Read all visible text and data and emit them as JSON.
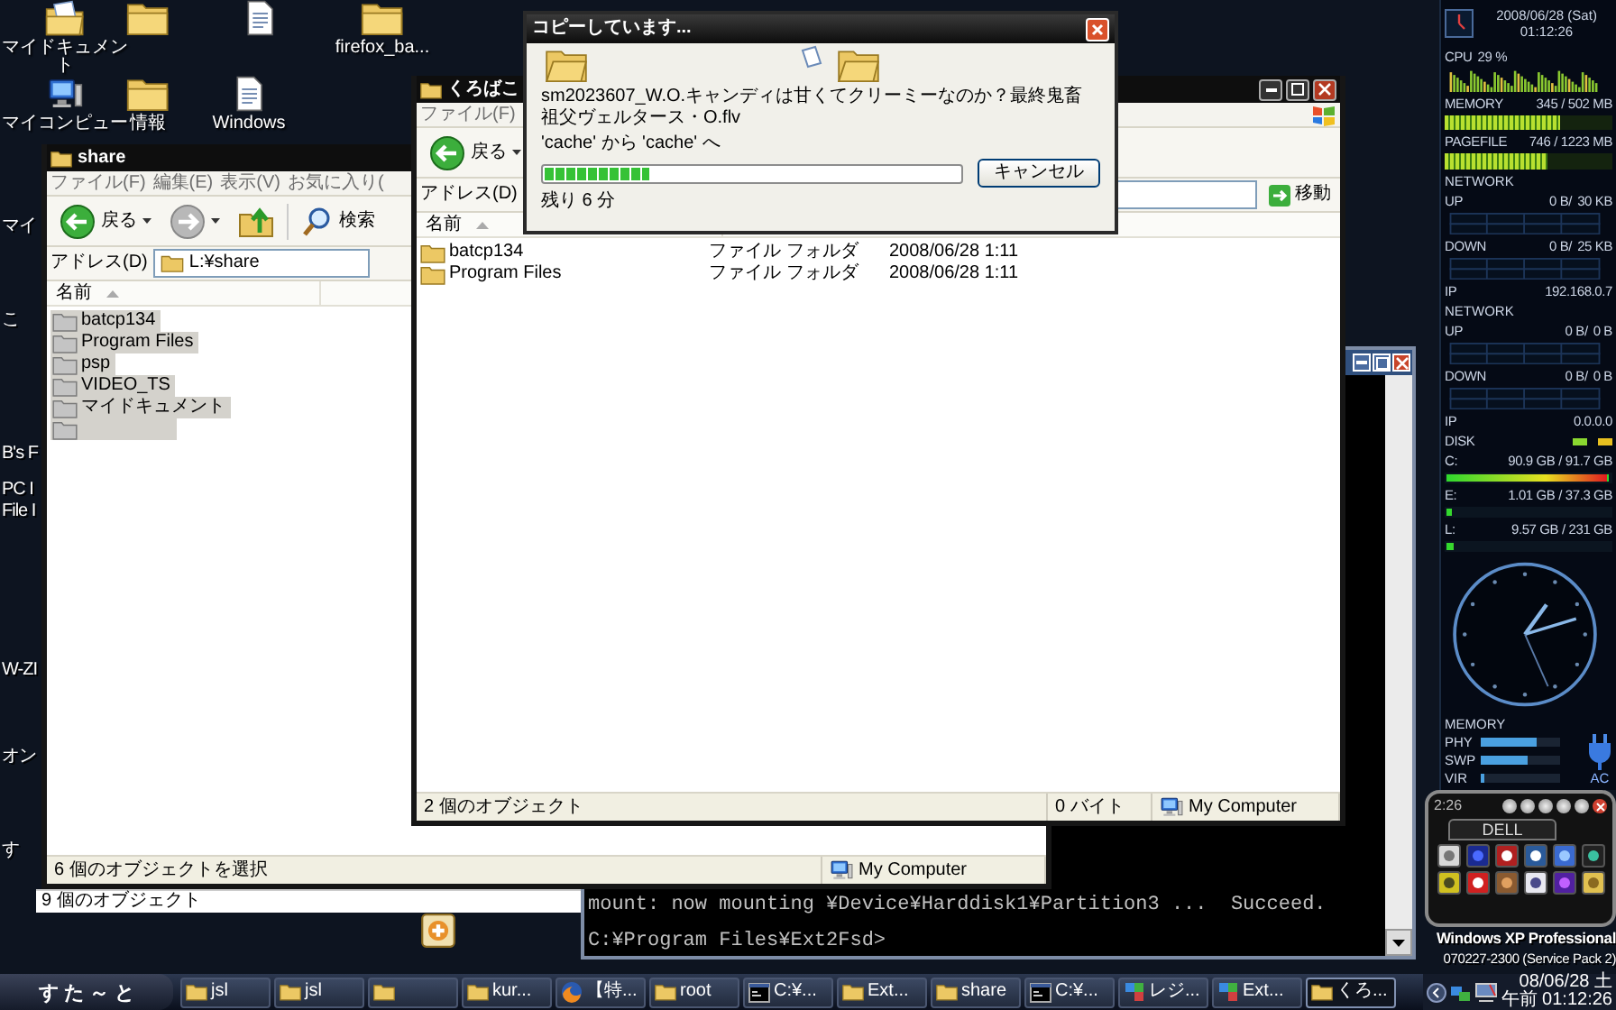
{
  "desktop": {
    "icons": [
      {
        "kind": "documents",
        "label": "マイドキュメント"
      },
      {
        "kind": "folder"
      },
      {
        "kind": "file"
      },
      {
        "kind": "folder",
        "label": "firefox_ba..."
      },
      {
        "kind": "computer",
        "label": "マイコンピュー"
      },
      {
        "kind": "folder",
        "label": "情報"
      },
      {
        "kind": "file",
        "label": "Windows"
      },
      {
        "kind": "app"
      }
    ],
    "edge_labels": [
      "マイ",
      "こ",
      "B's F",
      "PC I",
      "File I",
      "W-ZI",
      "オン",
      "す"
    ]
  },
  "back_window": {
    "status": "9 個のオブジェクト"
  },
  "console": {
    "lines": [
      "mount: now mounting ¥Device¥Harddisk1¥Partition3 ...  Succeed.",
      "C:¥Program Files¥Ext2Fsd>"
    ]
  },
  "share_window": {
    "title": "share",
    "menu": [
      "ファイル(F)",
      "編集(E)",
      "表示(V)",
      "お気に入り("
    ],
    "back": "戻る",
    "search": "検索",
    "address_label": "アドレス(D)",
    "address": "L:¥share",
    "column": "名前",
    "items": [
      {
        "name": "batcp134",
        "selected": true
      },
      {
        "name": "Program Files",
        "selected": true
      },
      {
        "name": "psp",
        "selected": true
      },
      {
        "name": "VIDEO_TS",
        "selected": true
      },
      {
        "name": "マイドキュメント",
        "selected": true
      },
      {
        "selected": true
      }
    ],
    "status": "6 個のオブジェクトを選択",
    "location": "My Computer"
  },
  "explorer_window": {
    "title": "くろばこ",
    "menu": [
      "ファイル(F)"
    ],
    "back": "戻る",
    "address_label": "アドレス(D)",
    "go": "移動",
    "column": "名前",
    "rows": [
      {
        "name": "batcp134",
        "type": "ファイル フォルダ",
        "date": "2008/06/28 1:11",
        "selected": false
      },
      {
        "name": "Program Files",
        "type": "ファイル フォルダ",
        "date": "2008/06/28 1:11",
        "selected": false
      }
    ],
    "status": "2 個のオブジェクト",
    "size": "0 バイト",
    "location": "My Computer"
  },
  "copy_dialog": {
    "title": "コピーしています...",
    "file": "sm2023607_W.O.キャンディは甘くてクリーミーなのか？最終鬼畜祖父ヴェルタース・O.flv",
    "route": "'cache' から 'cache' へ",
    "progress": {
      "level": 0.25
    },
    "cancel": "キャンセル",
    "remaining": "残り 6 分"
  },
  "system_monitor": {
    "date": "2008/06/28 (Sat)",
    "time": "01:12:26",
    "cpu_label": "CPU",
    "cpu_value": "29 %",
    "meters": [
      {
        "label": "MEMORY",
        "reading": "345 / 502 MB",
        "level": 0.69
      },
      {
        "label": "PAGEFILE",
        "reading": "746 / 1223 MB",
        "level": 0.61
      }
    ],
    "networks": [
      {
        "title": "NETWORK",
        "up_label": "UP",
        "up_now": "0 B/",
        "up_max": "30 KB",
        "down_label": "DOWN",
        "down_now": "0 B/",
        "down_max": "25 KB",
        "ip_label": "IP",
        "ip": "192.168.0.7"
      },
      {
        "title": "NETWORK",
        "up_label": "UP",
        "up_now": "0 B/",
        "up_max": "0 B",
        "down_label": "DOWN",
        "down_now": "0 B/",
        "down_max": "0 B",
        "ip_label": "IP",
        "ip": "0.0.0.0"
      }
    ],
    "disk_label": "DISK",
    "disks": [
      {
        "drive": "C:",
        "reading": "90.9 GB / 91.7 GB",
        "level": 0.99
      },
      {
        "drive": "E:",
        "reading": "1.01 GB / 37.3 GB",
        "level": 0.03
      },
      {
        "drive": "L:",
        "reading": "9.57 GB / 231 GB",
        "level": 0.04
      }
    ],
    "memory_label": "MEMORY",
    "memory_bars": [
      {
        "label": "PHY",
        "level": 0.7
      },
      {
        "label": "SWP",
        "level": 0.6
      },
      {
        "label": "VIR",
        "level": 0.05
      }
    ],
    "power": "AC"
  },
  "dock": {
    "time": "2:26",
    "tab": "DELL"
  },
  "os_banner": {
    "edition": "Windows XP Professional",
    "build": "070227-2300 (Service Pack 2)"
  },
  "taskbar": {
    "start": "す た ～ と",
    "buttons": [
      {
        "kind": "folder",
        "label": "jsl",
        "selected": false
      },
      {
        "kind": "folder",
        "label": "jsl",
        "selected": false
      },
      {
        "kind": "folder",
        "selected": false
      },
      {
        "kind": "folder",
        "label": "kur...",
        "selected": false
      },
      {
        "kind": "browser",
        "label": "【特...",
        "selected": false
      },
      {
        "kind": "folder",
        "label": "root",
        "selected": false
      },
      {
        "kind": "console",
        "label": "C:¥...",
        "selected": false
      },
      {
        "kind": "folder",
        "label": "Ext...",
        "selected": false
      },
      {
        "kind": "folder",
        "label": "share",
        "selected": false
      },
      {
        "kind": "console",
        "label": "C:¥...",
        "selected": false
      },
      {
        "kind": "registry",
        "label": "レジ...",
        "selected": false
      },
      {
        "kind": "registry",
        "label": "Ext...",
        "selected": false
      },
      {
        "kind": "folder",
        "label": "くろ...",
        "selected": true
      }
    ],
    "date": "08/06/28 土",
    "time": "午前 01:12:26"
  }
}
